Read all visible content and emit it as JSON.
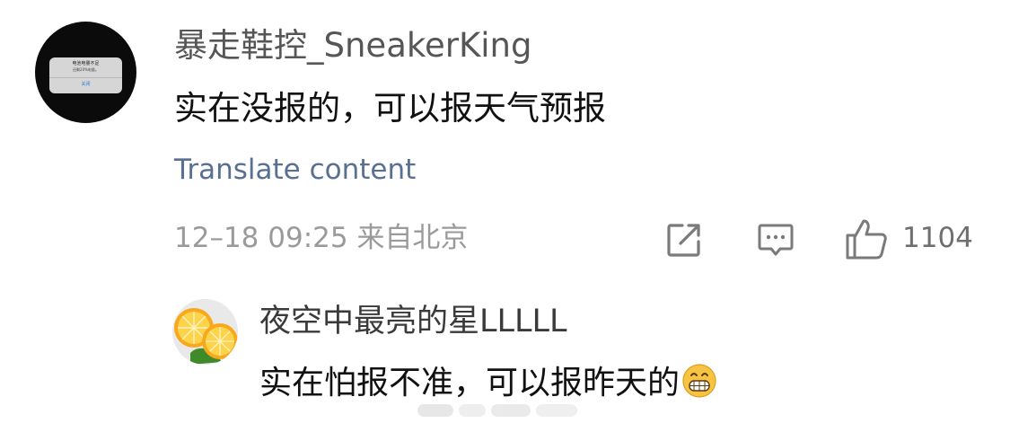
{
  "comment": {
    "username": "暴走鞋控_SneakerKing",
    "text": "实在没报的，可以报天气预报",
    "translate_label": "Translate content",
    "meta": "12–18 09:25 来自北京",
    "like_count": "1104",
    "avatar": {
      "alert_title": "电池电量不足",
      "alert_body": "还剩20%电量。",
      "alert_button": "关闭"
    }
  },
  "reply": {
    "username": "夜空中最亮的星LLLLL",
    "text": "实在怕报不准，可以报昨天的"
  },
  "icons": {
    "share": "share-icon",
    "comment": "comment-icon",
    "like": "thumbs-up-icon",
    "emoji": "grinning-face-icon"
  },
  "colors": {
    "link": "#5a7091",
    "meta": "#9a9a9a",
    "text": "#111111"
  }
}
